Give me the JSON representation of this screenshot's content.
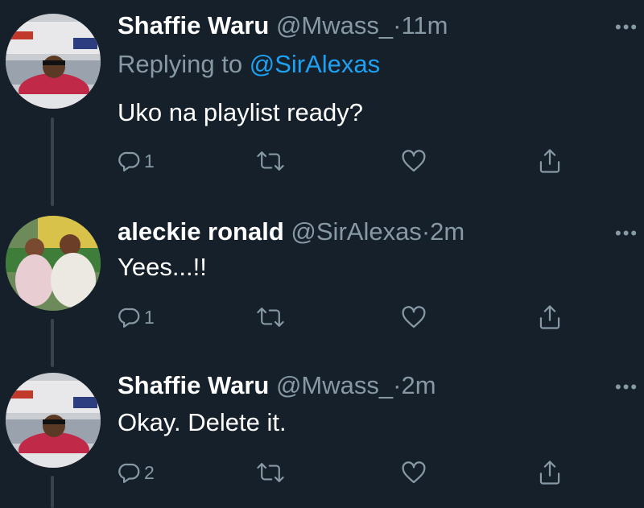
{
  "tweets": [
    {
      "name": "Shaffie Waru",
      "handle": "@Mwass_",
      "separator": "·",
      "time": "11m",
      "replying_prefix": "Replying to",
      "replying_to": "@SirAlexas",
      "text": "Uko na playlist ready?",
      "reply_count": "1",
      "more_label": "•••"
    },
    {
      "name": "aleckie ronald",
      "handle": "@SirAlexas",
      "separator": "·",
      "time": "2m",
      "text": "Yees...!!",
      "reply_count": "1",
      "more_label": "•••"
    },
    {
      "name": "Shaffie Waru",
      "handle": "@Mwass_",
      "separator": "·",
      "time": "2m",
      "text": "Okay. Delete it.",
      "reply_count": "2",
      "more_label": "•••"
    }
  ],
  "icons": {
    "reply": "reply-icon",
    "retweet": "retweet-icon",
    "like": "heart-icon",
    "share": "share-icon",
    "more": "more-icon"
  },
  "colors": {
    "background": "#15202b",
    "secondary_text": "#8899a6",
    "link": "#1da1f2",
    "thread_line": "#38444d"
  }
}
